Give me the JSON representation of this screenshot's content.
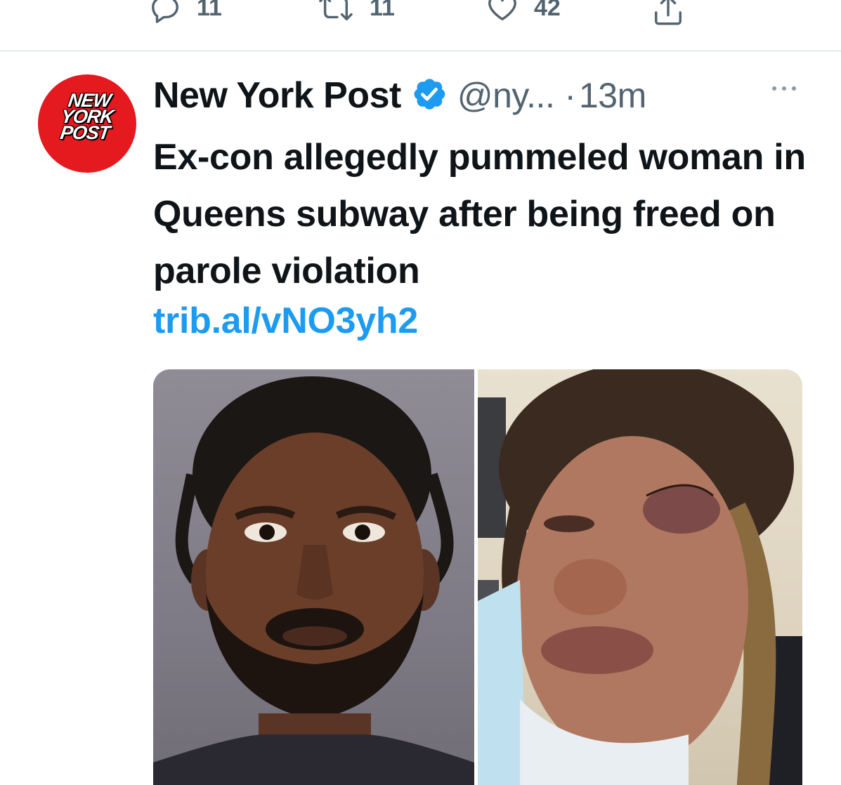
{
  "previous_tweet": {
    "reply_count": "11",
    "retweet_count": "11",
    "like_count": "42"
  },
  "tweet": {
    "display_name": "New York Post",
    "handle": "@ny...",
    "separator": "·",
    "time": "13m",
    "avatar_logo": [
      "NEW",
      "YORK",
      "POST"
    ],
    "text": "Ex-con allegedly pummeled woman in Queens subway after being freed on parole violation",
    "link": "trib.al/vNO3yh2"
  },
  "icons": {
    "reply": "reply-icon",
    "retweet": "retweet-icon",
    "like": "heart-icon",
    "share": "share-icon",
    "verified": "verified-badge-icon",
    "more": "more-options-icon"
  },
  "colors": {
    "link": "#1d9bf0",
    "verified": "#1d9bf0",
    "secondary_text": "#536471",
    "brand_red": "#e41a1f"
  }
}
